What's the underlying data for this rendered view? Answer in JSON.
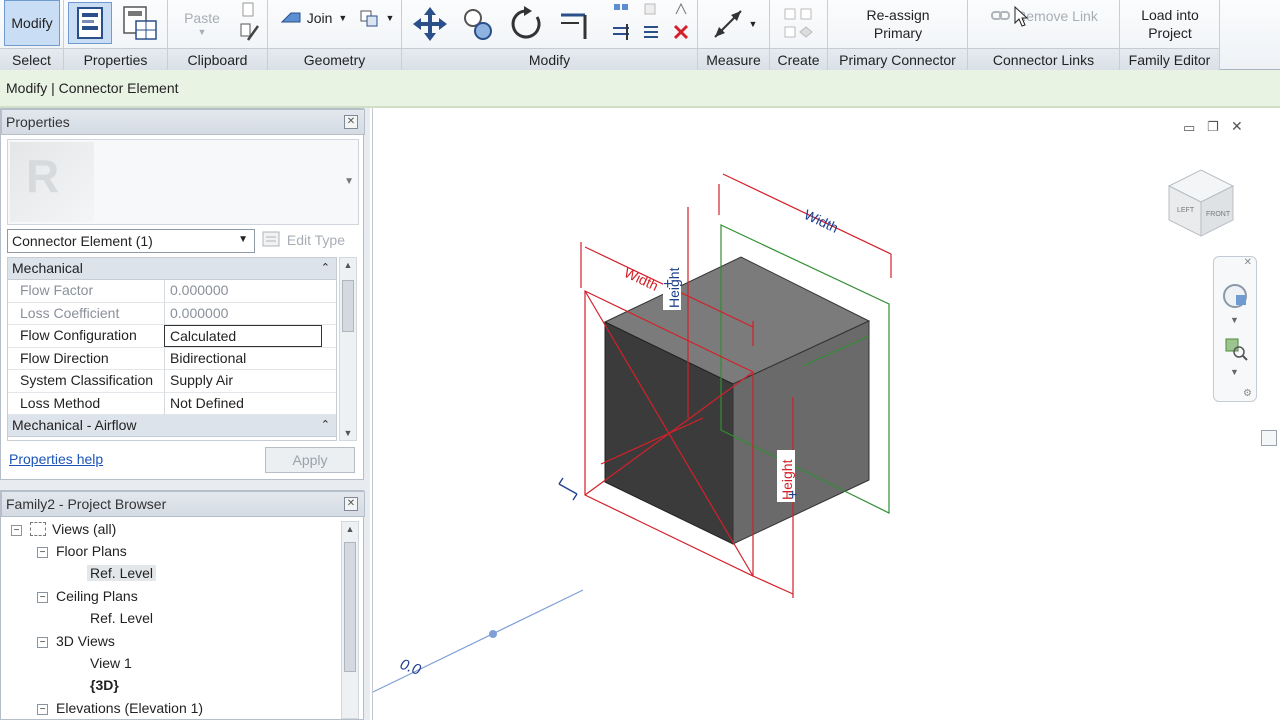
{
  "ribbon": {
    "select_panel": {
      "button": "Modify",
      "label": "Select"
    },
    "properties_panel": {
      "label": "Properties"
    },
    "clipboard_panel": {
      "paste": "Paste",
      "label": "Clipboard"
    },
    "geometry_panel": {
      "join": "Join",
      "label": "Geometry"
    },
    "modify_panel": {
      "label": "Modify"
    },
    "measure_panel": {
      "label": "Measure"
    },
    "create_panel": {
      "label": "Create"
    },
    "primary_connector_panel": {
      "button_line1": "Re-assign",
      "button_line2": "Primary",
      "label": "Primary Connector"
    },
    "connector_links_panel": {
      "button": "Remove Link",
      "label": "Connector Links"
    },
    "family_editor_panel": {
      "button_line1": "Load into",
      "button_line2": "Project",
      "label": "Family Editor"
    }
  },
  "options_bar": {
    "context": "Modify | Connector Element"
  },
  "properties": {
    "title": "Properties",
    "type_selector": "Connector Element (1)",
    "edit_type": "Edit Type",
    "groups": [
      {
        "name": "Mechanical",
        "rows": [
          {
            "name": "Flow Factor",
            "value": "0.000000"
          },
          {
            "name": "Loss Coefficient",
            "value": "0.000000"
          },
          {
            "name": "Flow Configuration",
            "value": "Calculated"
          },
          {
            "name": "Flow Direction",
            "value": "Bidirectional"
          },
          {
            "name": "System Classification",
            "value": "Supply Air"
          },
          {
            "name": "Loss Method",
            "value": "Not Defined"
          }
        ]
      },
      {
        "name": "Mechanical - Airflow"
      }
    ],
    "help_link": "Properties help",
    "apply": "Apply"
  },
  "project_browser": {
    "title": "Family2 - Project Browser",
    "items": [
      {
        "label": "Views (all)"
      },
      {
        "label": "Floor Plans"
      },
      {
        "label": "Ref. Level"
      },
      {
        "label": "Ceiling Plans"
      },
      {
        "label": "Ref. Level"
      },
      {
        "label": "3D Views"
      },
      {
        "label": "View 1"
      },
      {
        "label": "{3D}"
      },
      {
        "label": "Elevations (Elevation 1)"
      }
    ]
  },
  "canvas": {
    "labels": {
      "width_top": "Width",
      "width_left": "Width",
      "height_top": "Height",
      "height_right": "Height",
      "level": "0.0"
    },
    "viewcube": {
      "left": "LEFT",
      "front": "FRONT"
    }
  },
  "colors": {
    "ribbon_active": "#c9def5",
    "options_bar": "#e9f3e4",
    "reference_red": "#d4202a",
    "plane_green": "#2f8f2f",
    "dim_blue": "#1f3f8f",
    "link_blue": "#1a55b6"
  }
}
